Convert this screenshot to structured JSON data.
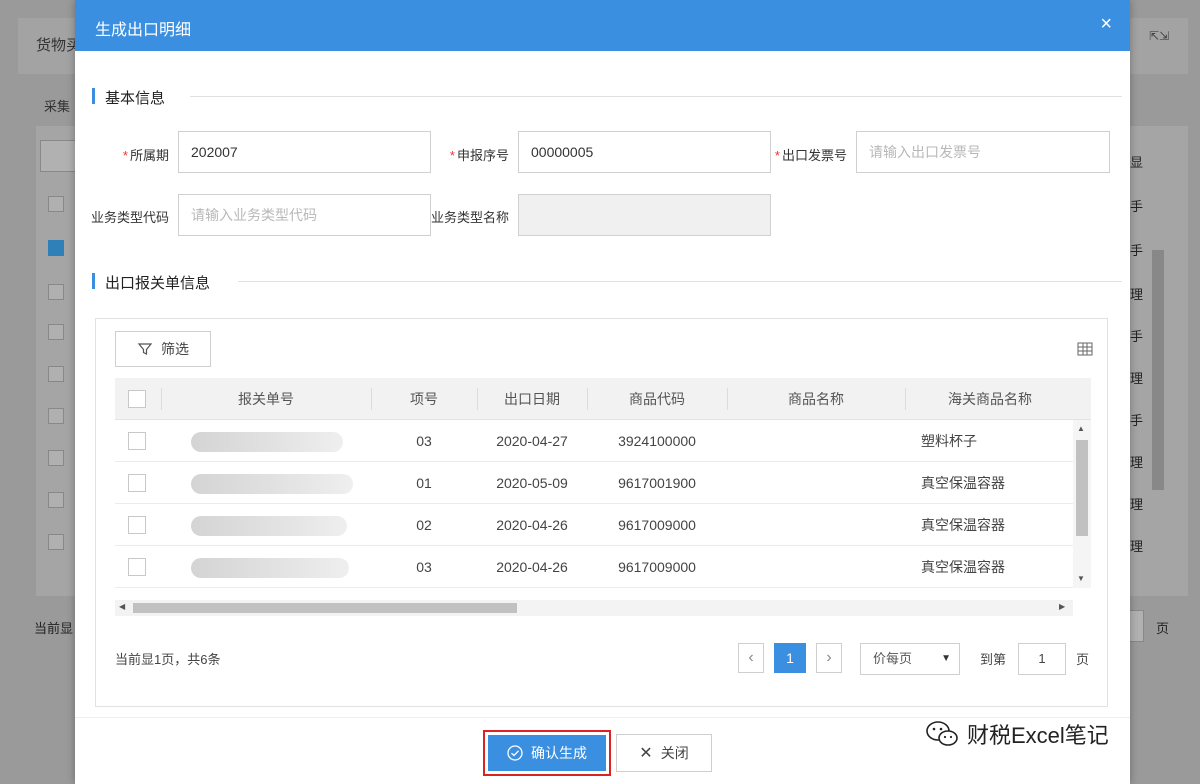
{
  "background": {
    "title": "货物买",
    "tab_text": "采集",
    "right_items": [
      "显",
      "手",
      "手",
      "理",
      "手",
      "理",
      "手",
      "理",
      "理",
      "理"
    ],
    "footer_left": "当前显",
    "footer_right": "页"
  },
  "modal": {
    "title": "生成出口明细",
    "close_glyph": "×",
    "section_basic": "基本信息",
    "section_customs": "出口报关单信息",
    "fields": {
      "period_label": "所属期",
      "period_value": "202007",
      "serial_label": "申报序号",
      "serial_value": "00000005",
      "invoice_label": "出口发票号",
      "invoice_placeholder": "请输入出口发票号",
      "biztype_code_label": "业务类型代码",
      "biztype_code_placeholder": "请输入业务类型代码",
      "biztype_name_label": "业务类型名称",
      "biztype_name_value": ""
    },
    "filter_label": "筛选",
    "columns": [
      "报关单号",
      "项号",
      "出口日期",
      "商品代码",
      "商品名称",
      "海关商品名称"
    ],
    "rows": [
      {
        "item": "03",
        "date": "2020-04-27",
        "code": "3924100000",
        "name": "",
        "customs_name": "塑料杯子"
      },
      {
        "item": "01",
        "date": "2020-05-09",
        "code": "9617001900",
        "name": "",
        "customs_name": "真空保温容器"
      },
      {
        "item": "02",
        "date": "2020-04-26",
        "code": "9617009000",
        "name": "",
        "customs_name": "真空保温容器"
      },
      {
        "item": "03",
        "date": "2020-04-26",
        "code": "9617009000",
        "name": "",
        "customs_name": "真空保温容器"
      }
    ],
    "pager": {
      "info": "当前显1页，共6条",
      "current_page": "1",
      "page_size_label": "价每页",
      "goto_label": "到第",
      "goto_value": "1",
      "page_suffix": "页"
    },
    "confirm_label": "确认生成",
    "close_label": "关闭"
  },
  "watermark": "财税Excel笔记",
  "colors": {
    "primary": "#3a8fe0",
    "highlight_border": "#dd2222",
    "required": "#ee3333"
  }
}
